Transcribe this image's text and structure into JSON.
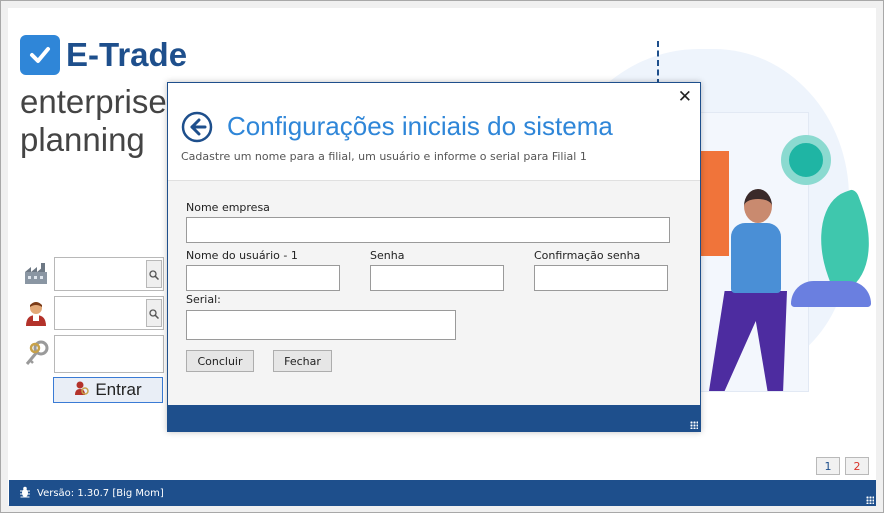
{
  "app": {
    "logo_text": "E-Trade",
    "tagline_line1": "enterprise",
    "tagline_line2": "planning"
  },
  "login": {
    "company_value": "",
    "user_value": "",
    "password_value": "",
    "enter_label": "Entrar"
  },
  "pager": {
    "page1": "1",
    "page2": "2"
  },
  "status": {
    "version_text": "Versão: 1.30.7 [Big Mom]"
  },
  "dialog": {
    "title": "Configurações iniciais do sistema",
    "subtitle": "Cadastre um nome para a filial, um usuário e informe o serial para Filial 1",
    "close_label": "✕",
    "company_label": "Nome empresa",
    "company_value": "",
    "user_label": "Nome do usuário - 1",
    "user_value": "",
    "password_label": "Senha",
    "password_value": "",
    "confirm_label": "Confirmação senha",
    "confirm_value": "",
    "serial_label": "Serial:",
    "serial_value": "",
    "finish_label": "Concluir",
    "close_button_label": "Fechar"
  },
  "icons": {
    "logo": "checkmark-icon",
    "company": "factory-icon",
    "user": "user-icon",
    "password": "keys-icon",
    "search": "magnifier-icon",
    "back": "back-arrow-icon",
    "status": "bug-icon"
  },
  "colors": {
    "brand_blue": "#1e4f8c",
    "accent_blue": "#2f86d8",
    "page2_text": "#d9342b"
  }
}
